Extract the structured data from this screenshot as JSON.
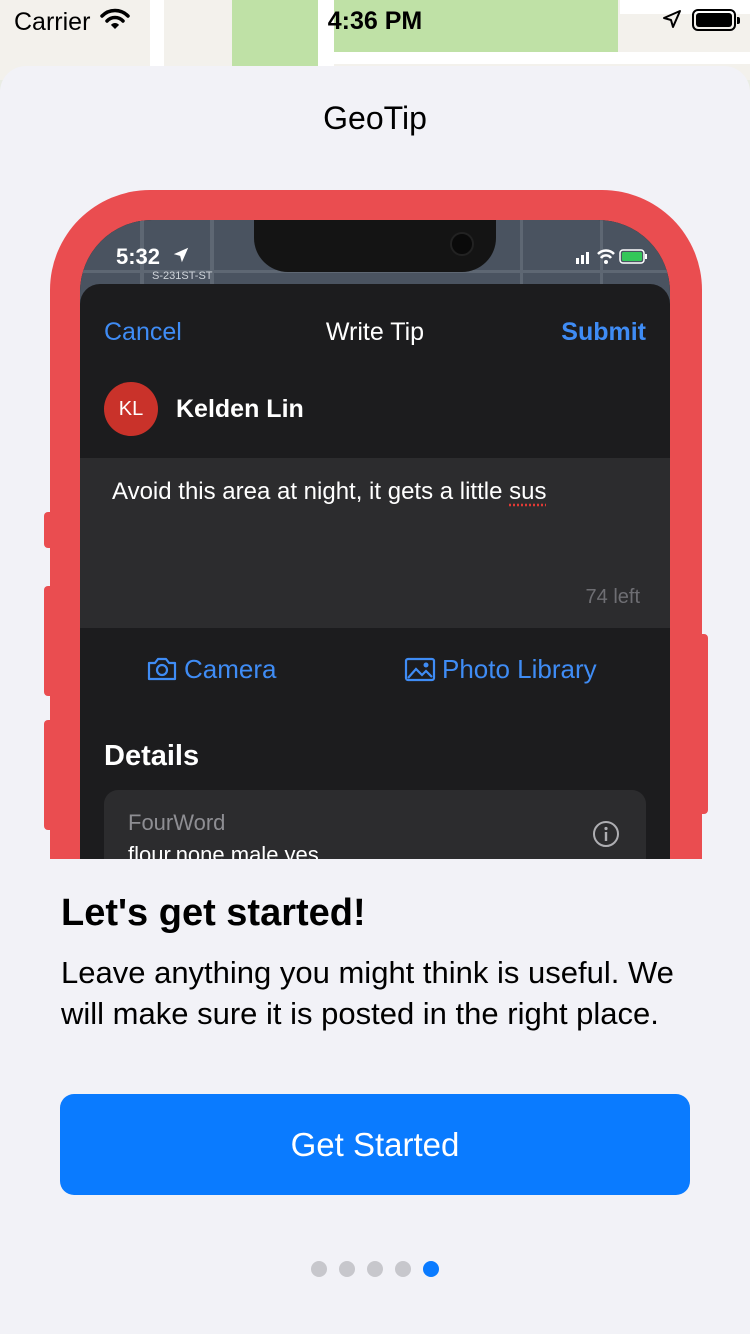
{
  "status_bar": {
    "carrier": "Carrier",
    "time": "4:36 PM"
  },
  "sheet": {
    "title": "GeoTip"
  },
  "mockup": {
    "status_time": "5:32",
    "street_label": "S-231ST-ST",
    "cancel_label": "Cancel",
    "nav_title": "Write Tip",
    "submit_label": "Submit",
    "avatar_initials": "KL",
    "user_name": "Kelden Lin",
    "tip_text": "Avoid this area at night, it gets a little ",
    "tip_text_flagged": "sus",
    "chars_left": "74 left",
    "camera_label": "Camera",
    "photo_library_label": "Photo Library",
    "details_heading": "Details",
    "field_label": "FourWord",
    "field_value": "flour.none.male.yes",
    "accent_color": "#3f8cf5"
  },
  "onboarding": {
    "headline": "Let's get started!",
    "description": "Leave anything you might think is useful. We will make sure it is posted in the right place.",
    "button_label": "Get Started",
    "page_count": 5,
    "current_page": 5,
    "accent_color": "#0a7bff"
  }
}
